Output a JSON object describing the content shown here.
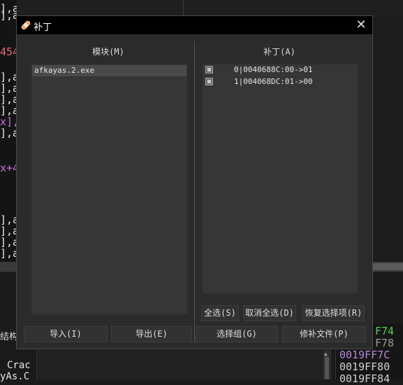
{
  "background": {
    "code_lines": [
      {
        "text": "],al",
        "color": "#e8e8e8"
      },
      {
        "text": "],al",
        "color": "#e8e8e8"
      },
      {
        "text": "454",
        "color": "#e06c75"
      },
      {
        "text": "],a",
        "color": "#e8e8e8"
      },
      {
        "text": "],a",
        "color": "#e8e8e8"
      },
      {
        "text": "],a",
        "color": "#e8e8e8"
      },
      {
        "text": "],a",
        "color": "#e8e8e8"
      },
      {
        "text": "x],",
        "color": "#c678dd"
      },
      {
        "text": "],a",
        "color": "#e8e8e8"
      },
      {
        "text": "x+4",
        "color": "#c678dd"
      },
      {
        "text": "],a",
        "color": "#e8e8e8"
      },
      {
        "text": "],a",
        "color": "#e8e8e8"
      },
      {
        "text": "],a",
        "color": "#e8e8e8"
      },
      {
        "text": "],a",
        "color": "#e8e8e8"
      }
    ],
    "side_label": "结构",
    "bottom_left_lines": [
      "Crac",
      "yAs.C"
    ],
    "addresses": [
      {
        "text": "F74",
        "color": "#50d060"
      },
      {
        "text": "F78",
        "color": "#9a9a9a"
      },
      {
        "text": "0019FF7C",
        "color": "#b48ad8"
      },
      {
        "text": "0019FF80",
        "color": "#cfcfcf"
      },
      {
        "text": "0019FF84",
        "color": "#cfcfcf"
      }
    ]
  },
  "dialog": {
    "title": "补丁",
    "close_symbol": "✕",
    "modules": {
      "title": "模块(M)",
      "items": [
        "afkayas.2.exe"
      ]
    },
    "patches": {
      "title": "补丁(A)",
      "items": [
        "0|0040688C:00->01",
        "1|004068DC:01->00"
      ]
    },
    "buttons": {
      "select_all": "全选(S)",
      "deselect_all": "取消全选(D)",
      "restore_selection": "恢复选择项(R)",
      "import": "导入(I)",
      "export": "导出(E)",
      "select_group": "选择组(G)",
      "patch_file": "修补文件(P)"
    }
  }
}
